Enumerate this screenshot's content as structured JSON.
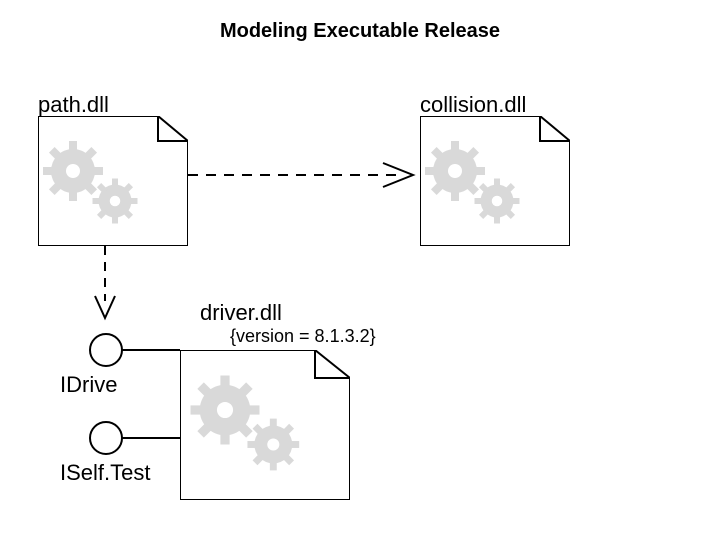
{
  "title": "Modeling Executable Release",
  "artifacts": {
    "path": {
      "label": "path.dll"
    },
    "collision": {
      "label": "collision.dll"
    },
    "driver": {
      "label": "driver.dll",
      "version": "{version = 8.1.3.2}"
    }
  },
  "interfaces": {
    "idrive": {
      "label": "IDrive"
    },
    "iselftest": {
      "label": "ISelf.Test"
    }
  }
}
